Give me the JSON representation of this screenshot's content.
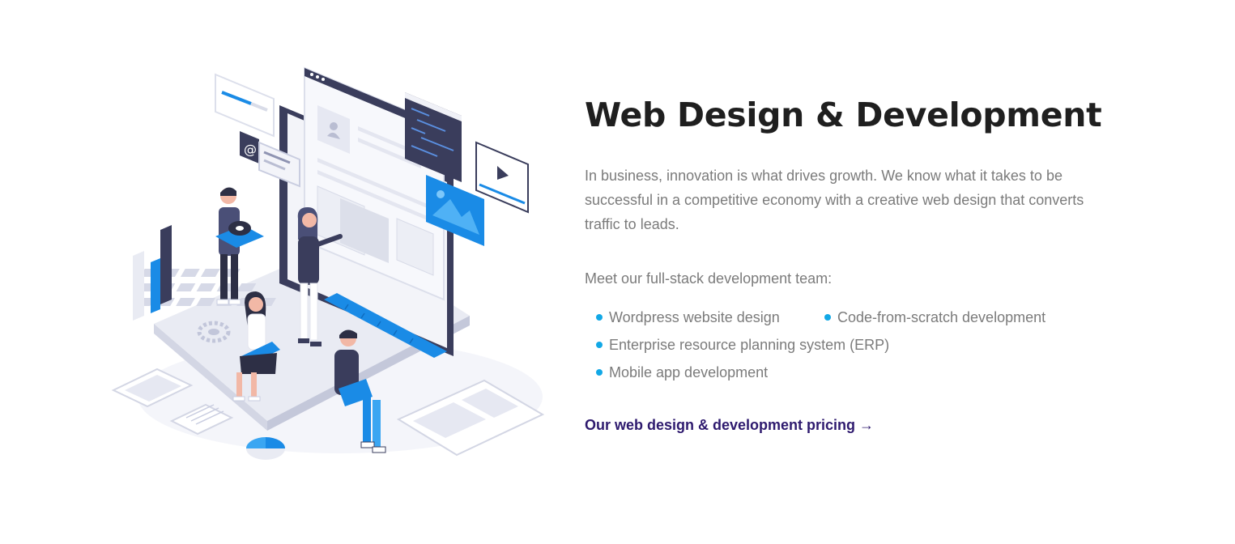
{
  "section": {
    "title": "Web Design & Development",
    "intro": "In business, innovation is what drives growth. We know what it takes to be successful in a competitive economy with a creative web design that converts traffic to leads.",
    "team_label": "Meet our full-stack development team:",
    "services": [
      "Wordpress website design",
      "Code-from-scratch development",
      "Enterprise resource planning system (ERP)",
      "Mobile app development"
    ],
    "pricing_link": "Our web design & development pricing →"
  },
  "illustration": {
    "email_glyph": "@"
  },
  "colors": {
    "title": "#1f1f1f",
    "body_text": "#7b7b7b",
    "bullet": "#12a8e6",
    "link": "#2e1a6e",
    "accent_blue": "#1a8be6",
    "dark_navy": "#3a3d5c"
  },
  "icons": [
    "bullet-dot-icon",
    "arrow-right-icon",
    "gear-icon",
    "user-avatar-icon",
    "play-icon",
    "image-icon",
    "email-icon"
  ]
}
